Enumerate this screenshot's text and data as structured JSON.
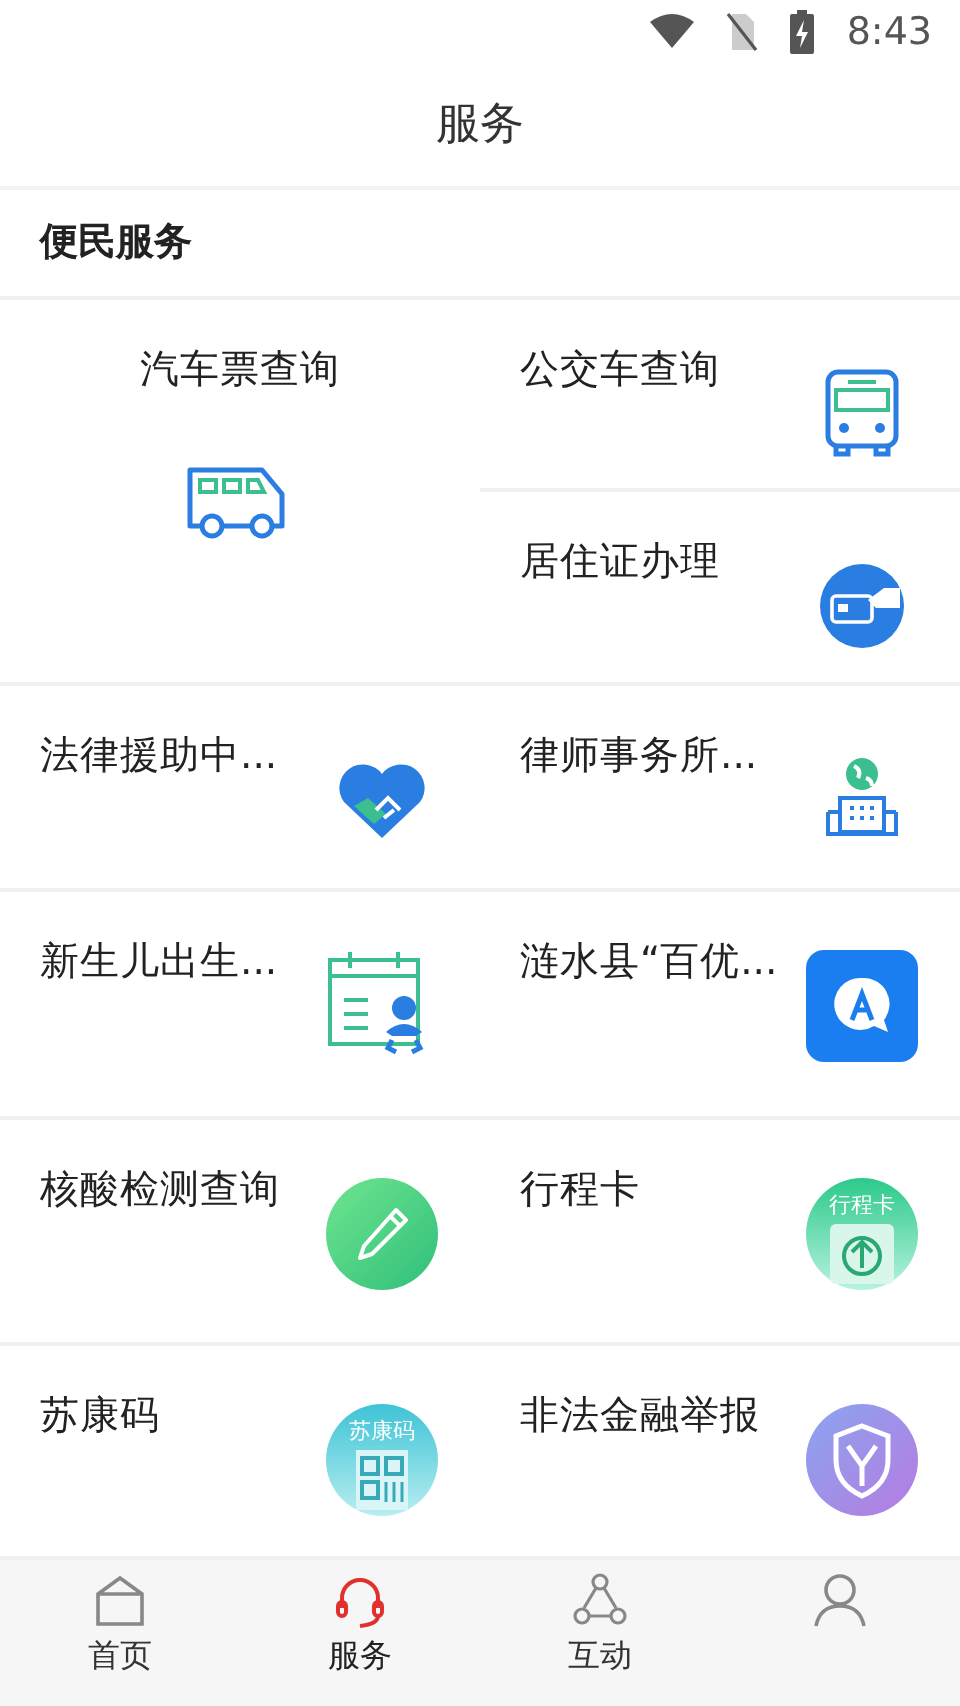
{
  "status_bar": {
    "time": "8:43"
  },
  "header": {
    "title": "服务"
  },
  "section": {
    "title": "便民服务"
  },
  "services": [
    {
      "label": "汽车票查询",
      "kind": "featured"
    },
    {
      "label": "公交车查询",
      "kind": "normal"
    },
    {
      "label": "居住证办理",
      "kind": "normal"
    },
    {
      "label": "法律援助中...",
      "kind": "normal"
    },
    {
      "label": "律师事务所...",
      "kind": "normal"
    },
    {
      "label": "新生儿出生...",
      "kind": "normal"
    },
    {
      "label": "涟水县“百优...",
      "kind": "normal"
    },
    {
      "label": "核酸检测查询",
      "kind": "normal"
    },
    {
      "label": "行程卡",
      "kind": "normal",
      "icon_text": "行程卡"
    },
    {
      "label": "苏康码",
      "kind": "normal",
      "icon_text": "苏康码"
    },
    {
      "label": "非法金融举报",
      "kind": "normal"
    }
  ],
  "bottom_nav": [
    {
      "label": "首页",
      "selected": false
    },
    {
      "label": "服务",
      "selected": true
    },
    {
      "label": "互动",
      "selected": false
    },
    {
      "selected": false
    }
  ]
}
